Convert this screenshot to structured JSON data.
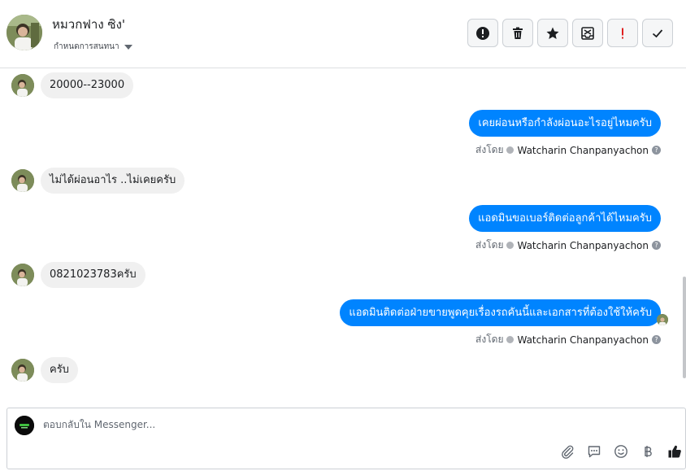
{
  "header": {
    "contact_name": "หมวกฟาง ซิง'",
    "subtitle": "กำหนดการสนทนา",
    "actions": [
      {
        "icon": "alert-icon",
        "label": "!"
      },
      {
        "icon": "trash-icon"
      },
      {
        "icon": "star-icon"
      },
      {
        "icon": "mark-unread-icon"
      },
      {
        "icon": "spam-icon",
        "label": "!"
      },
      {
        "icon": "check-icon"
      }
    ]
  },
  "messages": [
    {
      "direction": "in",
      "text": "20000--23000"
    },
    {
      "direction": "out",
      "text": "เคยผ่อนหรือกำลังผ่อนอะไรอยู่ไหมครับ",
      "sent_by_label": "ส่งโดย",
      "sender": "Watcharin Chanpanyachon"
    },
    {
      "direction": "in",
      "text": "ไม่ได้ผ่อนอาไร ..ไม่เคยครับ"
    },
    {
      "direction": "out",
      "text": "แอดมินขอเบอร์ติดต่อลูกค้าได้ไหมครับ",
      "sent_by_label": "ส่งโดย",
      "sender": "Watcharin Chanpanyachon"
    },
    {
      "direction": "in",
      "text": "0821023783ครับ"
    },
    {
      "direction": "out",
      "text": "แอดมินติดต่อฝ่ายขายพูดคุยเรื่องรถคันนี้และเอกสารที่ต้องใช้ให้ครับ",
      "sent_by_label": "ส่งโดย",
      "sender": "Watcharin Chanpanyachon"
    },
    {
      "direction": "in",
      "text": "ครับ"
    }
  ],
  "composer": {
    "placeholder": "ตอบกลับใน Messenger...",
    "tools": [
      "attachment-icon",
      "saved-reply-icon",
      "emoji-icon",
      "baht-icon",
      "thumbs-up-icon"
    ]
  },
  "colors": {
    "outgoing_bubble": "#0084ff",
    "incoming_bubble": "#f0f0f0",
    "like_icon": "#1c1e21"
  }
}
